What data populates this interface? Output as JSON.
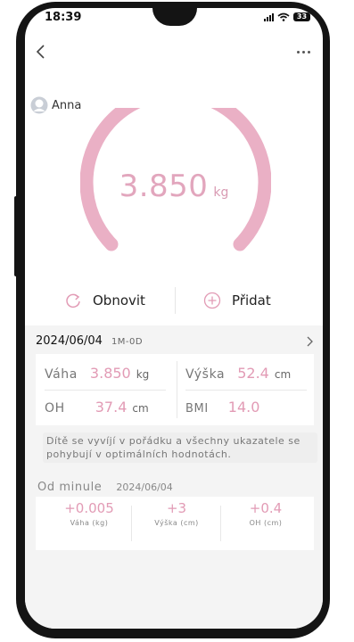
{
  "status": {
    "time": "18:39",
    "battery": "33"
  },
  "user": {
    "name": "Anna"
  },
  "measurement": {
    "weight": "3.850",
    "unit": "kg",
    "gauge_fill": 1.0
  },
  "actions": {
    "refresh_label": "Obnovit",
    "add_label": "Přidat"
  },
  "record": {
    "date": "2024/06/04",
    "age": "1M-0D",
    "metrics": {
      "weight": {
        "label": "Váha",
        "value": "3.850",
        "unit": "kg"
      },
      "height": {
        "label": "Výška",
        "value": "52.4",
        "unit": "cm"
      },
      "head": {
        "label": "OH",
        "value": "37.4",
        "unit": "cm"
      },
      "bmi": {
        "label": "BMI",
        "value": "14.0"
      }
    },
    "note": "Dítě se vyvíjí v pořádku a všechny ukazatele se pohybují v optimálních hodnotách."
  },
  "since_last": {
    "label": "Od minule",
    "date": "2024/06/04",
    "items": [
      {
        "value": "+0.005",
        "label": "Váha (kg)"
      },
      {
        "value": "+3",
        "label": "Výška (cm)"
      },
      {
        "value": "+0.4",
        "label": "OH (cm)"
      }
    ]
  },
  "colors": {
    "accent": "#e29bb5",
    "gauge": "#eab0c5",
    "panel": "#f4f4f4"
  }
}
